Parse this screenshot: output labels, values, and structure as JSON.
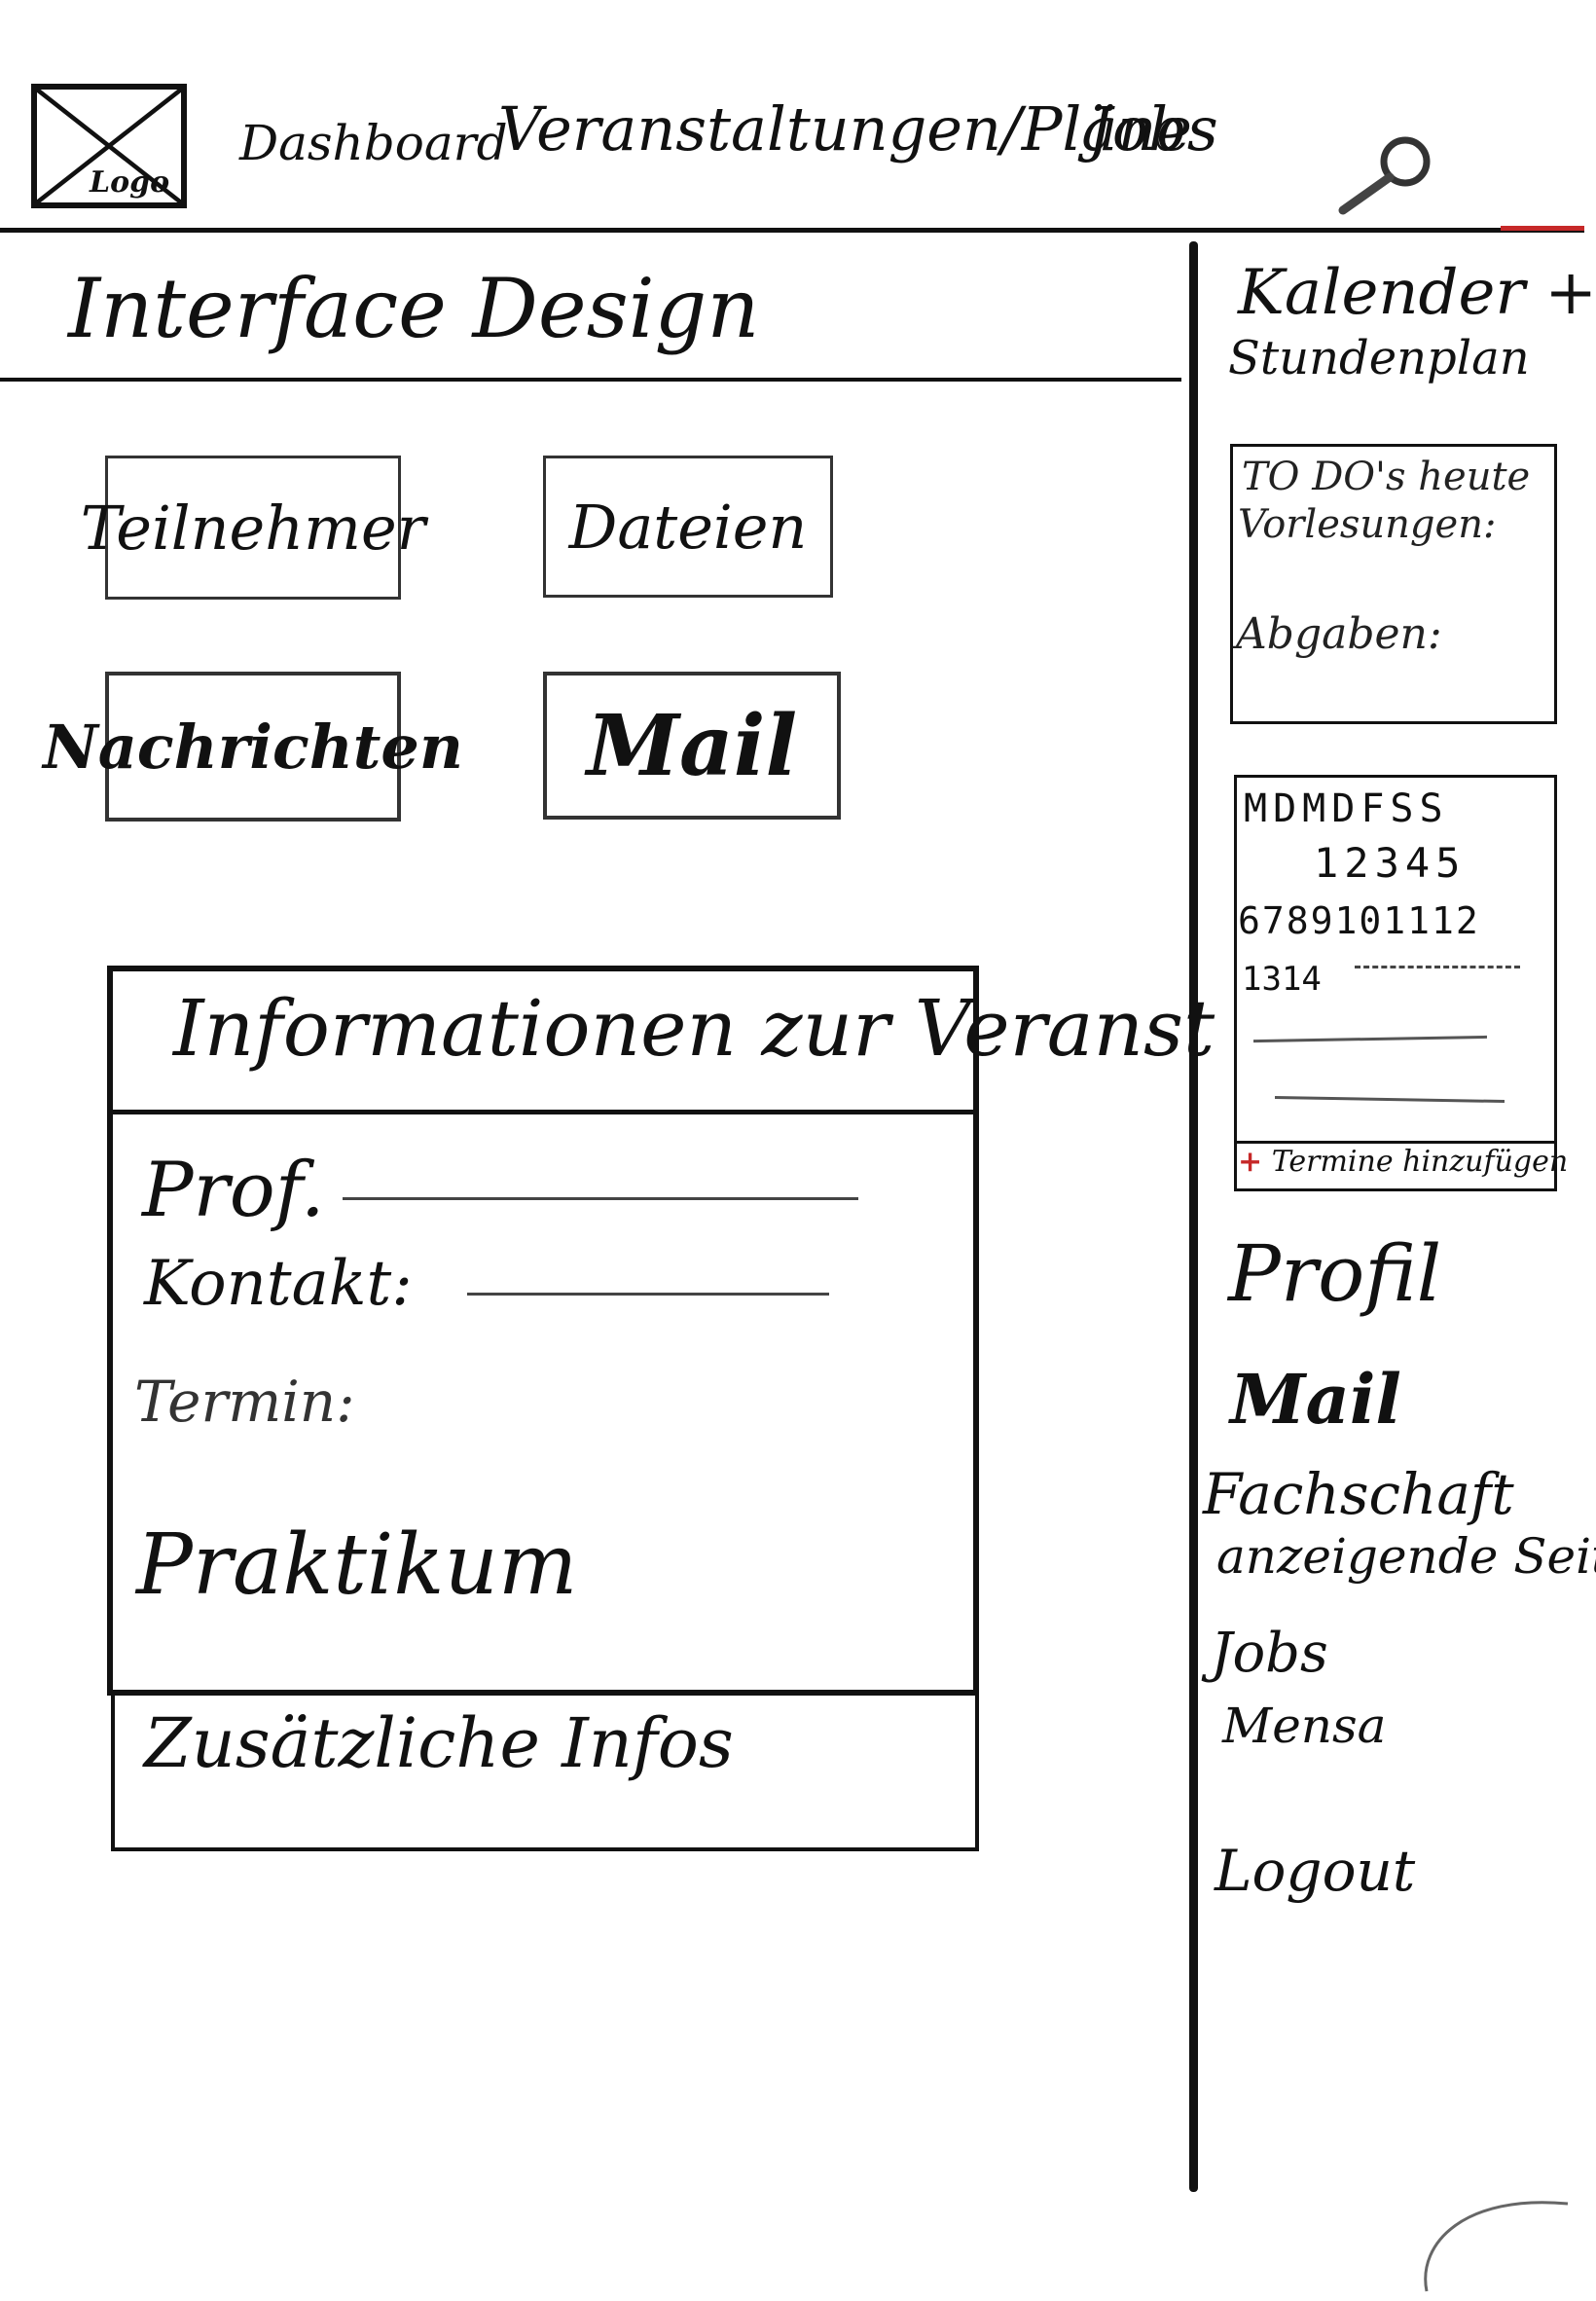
{
  "header": {
    "logo_text": "Logo",
    "nav": {
      "dashboard": "Dashboard",
      "events": "Veranstaltungen/Pläne",
      "jobs": "Jobs"
    },
    "search_icon": "search-icon"
  },
  "course": {
    "title": "Interface Design"
  },
  "tiles": {
    "participants": "Teilnehmer",
    "files": "Dateien",
    "messages": "Nachrichten",
    "mail": "Mail"
  },
  "info": {
    "title": "Informationen zur Veranst",
    "prof_label": "Prof.",
    "contact_label": "Kontakt:",
    "date_label": "Termin:",
    "internship_label": "Praktikum",
    "extra_label": "Zusätzliche Infos"
  },
  "sidebar": {
    "calendar_title": "Kalender +",
    "calendar_subtitle": "Stundenplan",
    "todo": {
      "lectures_label": "TO DO's heute",
      "lectures_label2": "Vorlesungen:",
      "deadlines_label": "Abgaben:"
    },
    "calendar": {
      "weekdays": "MDMDFSS",
      "row1": "12345",
      "row2": "6789101112",
      "row3": "1314",
      "add_label": "Termine hinzufügen"
    },
    "menu": {
      "profile": "Profil",
      "mail": "Mail",
      "department": "Fachschaft",
      "department2": "anzeigende Seite",
      "jobs": "Jobs",
      "mensa": "Mensa",
      "logout": "Logout"
    }
  },
  "colors": {
    "ink": "#111111",
    "accent": "#c62828",
    "background": "#ffffff"
  }
}
